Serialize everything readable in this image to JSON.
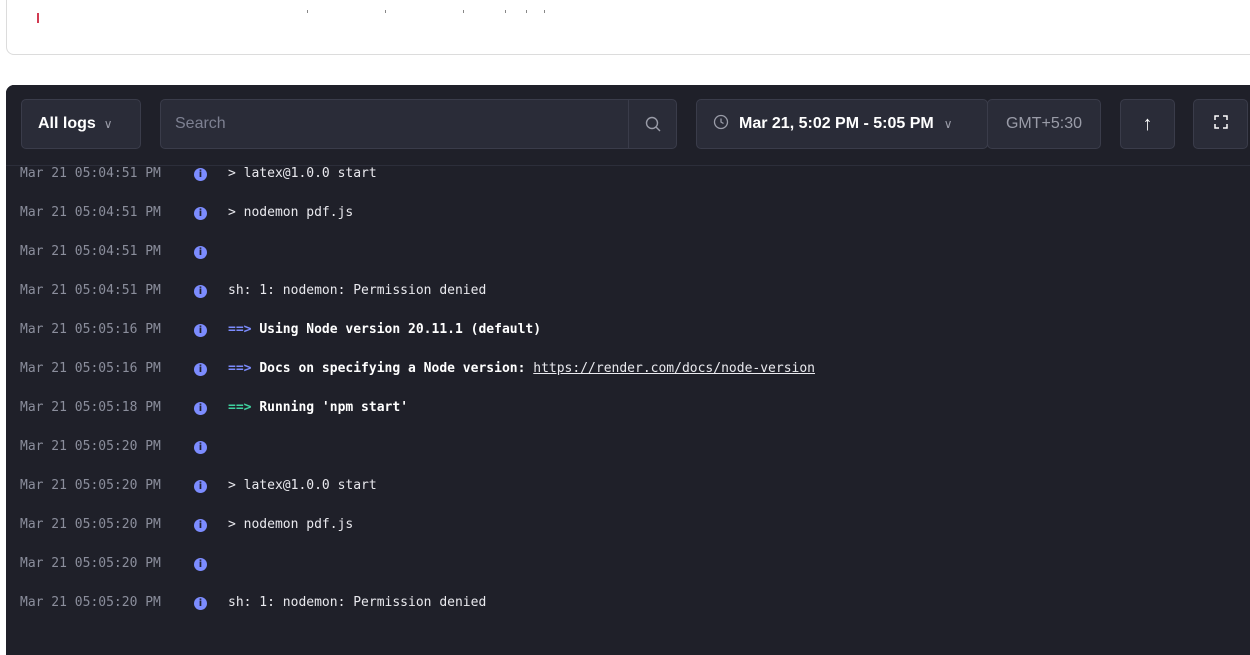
{
  "toolbar": {
    "log_filter": "All logs",
    "search_placeholder": "Search",
    "date_range": "Mar 21, 5:02 PM - 5:05 PM",
    "timezone": "GMT+5:30"
  },
  "colors": {
    "panel_bg": "#1f2029",
    "accent_blue": "#7c8cff",
    "accent_green": "#3fd3a0"
  },
  "logs": [
    {
      "ts": "Mar 21 05:04:51 PM",
      "text": "> latex@1.0.0 start"
    },
    {
      "ts": "Mar 21 05:04:51 PM",
      "text": "> nodemon pdf.js"
    },
    {
      "ts": "Mar 21 05:04:51 PM",
      "text": ""
    },
    {
      "ts": "Mar 21 05:04:51 PM",
      "text": "sh: 1: nodemon: Permission denied"
    },
    {
      "ts": "Mar 21 05:05:16 PM",
      "prefix": "==>",
      "text": "Using Node version 20.11.1 (default)"
    },
    {
      "ts": "Mar 21 05:05:16 PM",
      "prefix": "==>",
      "text": "Docs on specifying a Node version:",
      "link": "https://render.com/docs/node-version"
    },
    {
      "ts": "Mar 21 05:05:18 PM",
      "prefix": "==>",
      "text": "Running 'npm start'"
    },
    {
      "ts": "Mar 21 05:05:20 PM",
      "text": ""
    },
    {
      "ts": "Mar 21 05:05:20 PM",
      "text": "> latex@1.0.0 start"
    },
    {
      "ts": "Mar 21 05:05:20 PM",
      "text": "> nodemon pdf.js"
    },
    {
      "ts": "Mar 21 05:05:20 PM",
      "text": ""
    },
    {
      "ts": "Mar 21 05:05:20 PM",
      "text": "sh: 1: nodemon: Permission denied"
    }
  ]
}
